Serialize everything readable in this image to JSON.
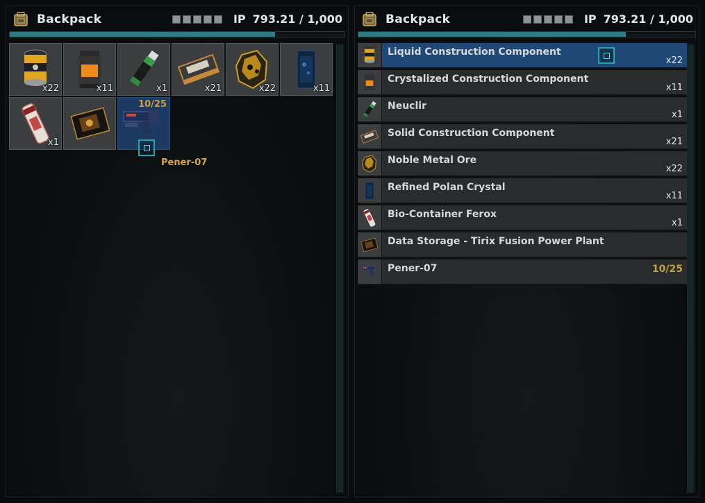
{
  "panels": [
    {
      "title": "Backpack",
      "ip_label": "IP",
      "ip_value": "793.21 / 1,000",
      "weight_fraction": 0.7932
    },
    {
      "title": "Backpack",
      "ip_label": "IP",
      "ip_value": "793.21 / 1,000",
      "weight_fraction": 0.7932
    }
  ],
  "items": [
    {
      "name": "Liquid Construction Component",
      "qty": "x22",
      "icon": "liquid-canister-icon"
    },
    {
      "name": "Crystalized Construction Component",
      "qty": "x11",
      "icon": "crystal-canister-icon"
    },
    {
      "name": "Neuclir",
      "qty": "x1",
      "icon": "neuclir-tube-icon"
    },
    {
      "name": "Solid Construction Component",
      "qty": "x21",
      "icon": "solid-box-icon"
    },
    {
      "name": "Noble Metal Ore",
      "qty": "x22",
      "icon": "ore-rock-icon"
    },
    {
      "name": "Refined Polan Crystal",
      "qty": "x11",
      "icon": "polan-crystal-icon"
    },
    {
      "name": "Bio-Container Ferox",
      "qty": "x1",
      "icon": "bio-container-icon"
    },
    {
      "name": "Data Storage - Tirix Fusion Power Plant",
      "qty": "",
      "icon": "data-chip-icon"
    },
    {
      "name": "Pener-07",
      "qty": "",
      "durability": "10/25",
      "icon": "pistol-icon"
    }
  ],
  "hover_tooltip": "Pener-07",
  "colors": {
    "accent": "#1fa4b0",
    "selected": "#1f4877",
    "durability": "#c9a040",
    "weight_bar": "#2f7a87"
  }
}
